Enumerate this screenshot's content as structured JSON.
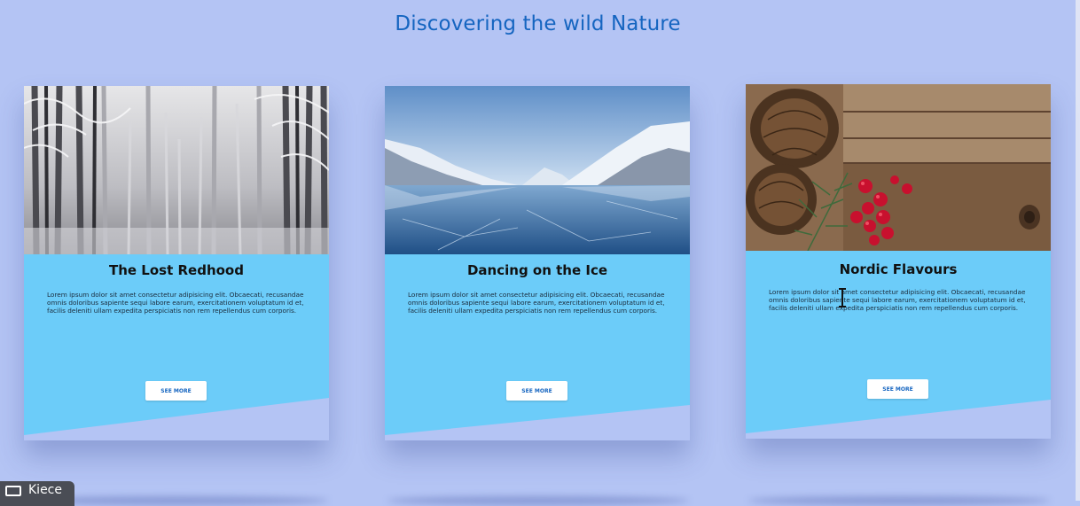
{
  "page": {
    "title": "Discovering the wild Nature"
  },
  "cards": [
    {
      "title": "The Lost Redhood",
      "text": "Lorem ipsum dolor sit amet consectetur adipisicing elit. Obcaecati, recusandae omnis doloribus sapiente sequi labore earum, exercitationem voluptatum id et, facilis deleniti ullam expedita perspiciatis non rem repellendus cum corporis.",
      "button": "SEE MORE",
      "image": "snowy-forest-image"
    },
    {
      "title": "Dancing on the Ice",
      "text": "Lorem ipsum dolor sit amet consectetur adipisicing elit. Obcaecati, recusandae omnis doloribus sapiente sequi labore earum, exercitationem voluptatum id et, facilis deleniti ullam expedita perspiciatis non rem repellendus cum corporis.",
      "button": "SEE MORE",
      "image": "frozen-lake-mountains-image"
    },
    {
      "title": "Nordic Flavours",
      "text": "Lorem ipsum dolor sit amet consectetur adipisicing elit. Obcaecati, recusandae omnis doloribus sapiente sequi labore earum, exercitationem voluptatum id et, facilis deleniti ullam expedita perspiciatis non rem repellendus cum corporis.",
      "button": "SEE MORE",
      "image": "pinecones-berries-wood-image"
    }
  ],
  "overlay": {
    "caption_label": "Kiece",
    "caption_icon": "caption-icon"
  },
  "colors": {
    "background": "#b4c4f4",
    "title": "#1565c0",
    "card": "#6cccf9",
    "button_text": "#1565c0"
  }
}
